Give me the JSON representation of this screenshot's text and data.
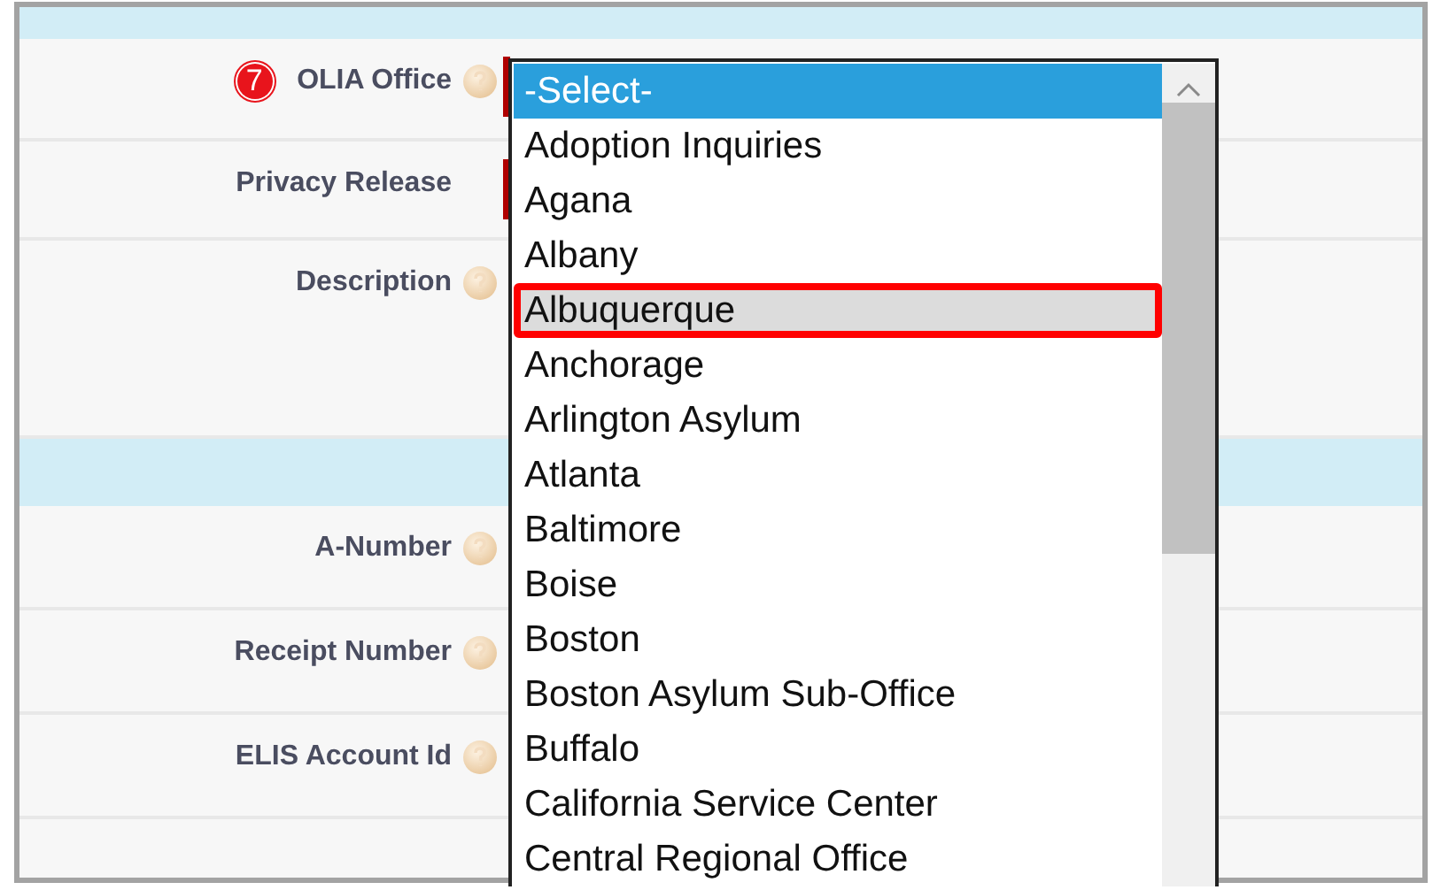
{
  "form": {
    "rows": [
      {
        "kind": "band"
      },
      {
        "kind": "field",
        "label": "OLIA Office",
        "step": "7",
        "help": true,
        "required": true
      },
      {
        "kind": "field",
        "label": "Privacy Release",
        "help": false,
        "required": true
      },
      {
        "kind": "textarea",
        "label": "Description",
        "help": true,
        "required": false
      },
      {
        "kind": "band"
      },
      {
        "kind": "field",
        "label": "A-Number",
        "help": true,
        "required": false
      },
      {
        "kind": "field",
        "label": "Receipt Number",
        "help": true,
        "required": false
      },
      {
        "kind": "field",
        "label": "ELIS Account Id",
        "help": true,
        "required": false
      },
      {
        "kind": "field",
        "required": false,
        "help": false
      }
    ]
  },
  "dropdown": {
    "options": [
      {
        "label": "-Select-",
        "selected": true,
        "hovered": false,
        "callout": false
      },
      {
        "label": "Adoption Inquiries",
        "selected": false,
        "hovered": false,
        "callout": false
      },
      {
        "label": "Agana",
        "selected": false,
        "hovered": false,
        "callout": false
      },
      {
        "label": "Albany",
        "selected": false,
        "hovered": false,
        "callout": false
      },
      {
        "label": "Albuquerque",
        "selected": false,
        "hovered": true,
        "callout": true
      },
      {
        "label": "Anchorage",
        "selected": false,
        "hovered": false,
        "callout": false
      },
      {
        "label": "Arlington Asylum",
        "selected": false,
        "hovered": false,
        "callout": false
      },
      {
        "label": "Atlanta",
        "selected": false,
        "hovered": false,
        "callout": false
      },
      {
        "label": "Baltimore",
        "selected": false,
        "hovered": false,
        "callout": false
      },
      {
        "label": "Boise",
        "selected": false,
        "hovered": false,
        "callout": false
      },
      {
        "label": "Boston",
        "selected": false,
        "hovered": false,
        "callout": false
      },
      {
        "label": "Boston Asylum Sub-Office",
        "selected": false,
        "hovered": false,
        "callout": false
      },
      {
        "label": "Buffalo",
        "selected": false,
        "hovered": false,
        "callout": false
      },
      {
        "label": "California Service Center",
        "selected": false,
        "hovered": false,
        "callout": false
      },
      {
        "label": "Central Regional Office",
        "selected": false,
        "hovered": false,
        "callout": false
      }
    ]
  }
}
